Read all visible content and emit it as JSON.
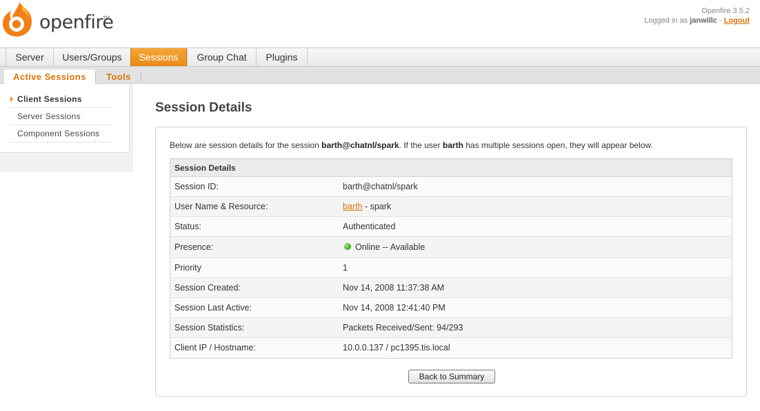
{
  "header": {
    "logo_text": "openfire",
    "logo_tm": "TM",
    "version": "Openfire 3.5.2",
    "logged_in_prefix": "Logged in as",
    "username": "janwillc",
    "separator": "-",
    "logout_label": "Logout"
  },
  "tabs": [
    {
      "label": "Server"
    },
    {
      "label": "Users/Groups"
    },
    {
      "label": "Sessions"
    },
    {
      "label": "Group Chat"
    },
    {
      "label": "Plugins"
    }
  ],
  "active_tab": "Sessions",
  "subtabs": [
    {
      "label": "Active Sessions"
    },
    {
      "label": "Tools"
    }
  ],
  "sidebar": {
    "items": [
      {
        "label": "Client Sessions"
      },
      {
        "label": "Server Sessions"
      },
      {
        "label": "Component Sessions"
      }
    ]
  },
  "page": {
    "title": "Session Details",
    "intro_prefix": "Below are session details for the session",
    "intro_session": "barth@chatnl/spark",
    "intro_mid": ". If the user",
    "intro_user": "barth",
    "intro_suffix": "has multiple sessions open, they will appear below.",
    "table_header": "Session Details",
    "rows": [
      {
        "label": "Session ID:",
        "value": "barth@chatnl/spark"
      },
      {
        "label": "User Name & Resource:",
        "user": "barth",
        "value": " - spark"
      },
      {
        "label": "Status:",
        "value": "Authenticated"
      },
      {
        "label": "Presence:",
        "value": "Online -- Available"
      },
      {
        "label": "Priority",
        "value": "1"
      },
      {
        "label": "Session Created:",
        "value": "Nov 14, 2008 11:37:38 AM"
      },
      {
        "label": "Session Last Active:",
        "value": "Nov 14, 2008 12:41:40 PM"
      },
      {
        "label": "Session Statistics:",
        "value": "Packets Received/Sent: 94/293"
      },
      {
        "label": "Client IP / Hostname:",
        "value": "10.0.0.137 / pc1395.tis.local"
      }
    ],
    "back_button": "Back to Summary"
  },
  "colors": {
    "accent": "#e88a18",
    "link": "#d5730d",
    "presence_online": "#3aa51b"
  }
}
